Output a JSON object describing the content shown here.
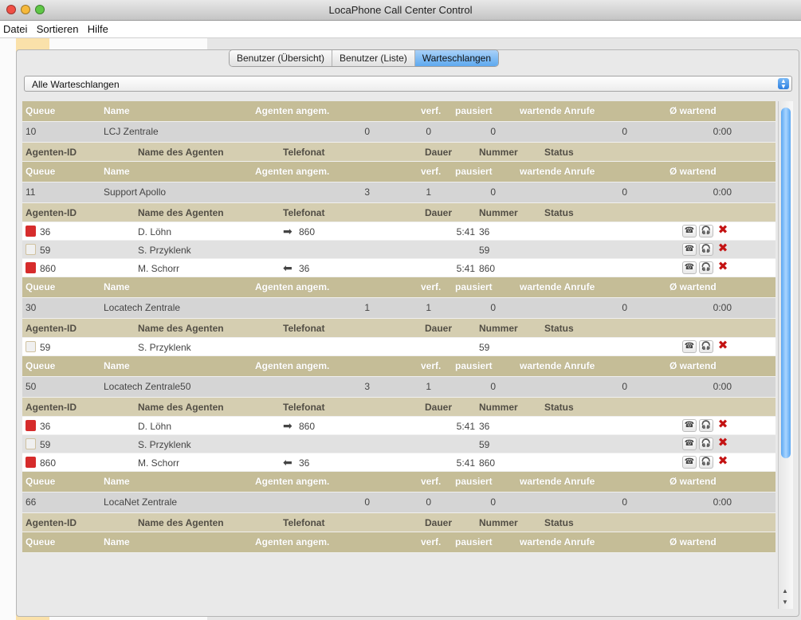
{
  "window": {
    "title": "LocaPhone Call Center Control"
  },
  "menu": [
    "Datei",
    "Sortieren",
    "Hilfe"
  ],
  "tabs": [
    "Benutzer (Übersicht)",
    "Benutzer (Liste)",
    "Warteschlangen"
  ],
  "active_tab": 2,
  "filter": {
    "selected": "Alle Warteschlangen"
  },
  "headers": {
    "queue": [
      "Queue",
      "Name",
      "Agenten angem.",
      "verf.",
      "pausiert",
      "wartende Anrufe",
      "Ø wartend"
    ],
    "agent": [
      "Agenten-ID",
      "Name des Agenten",
      "Telefonat",
      "Dauer",
      "Nummer",
      "Status"
    ]
  },
  "queues": [
    {
      "id": "10",
      "name": "LCJ Zentrale",
      "angemeldet": "0",
      "verf": "0",
      "pausiert": "0",
      "wartend": "0",
      "avg": "0:00",
      "agents": []
    },
    {
      "id": "11",
      "name": "Support Apollo",
      "angemeldet": "3",
      "verf": "1",
      "pausiert": "0",
      "wartend": "0",
      "avg": "0:00",
      "agents": [
        {
          "id": "36",
          "name": "D. Löhn",
          "call_dir": "out",
          "call": "860",
          "dauer": "5:41",
          "nummer": "36",
          "status": "busy"
        },
        {
          "id": "59",
          "name": "S. Przyklenk",
          "call_dir": "",
          "call": "",
          "dauer": "",
          "nummer": "59",
          "status": "idle"
        },
        {
          "id": "860",
          "name": "M. Schorr",
          "call_dir": "in",
          "call": "36",
          "dauer": "5:41",
          "nummer": "860",
          "status": "busy"
        }
      ]
    },
    {
      "id": "30",
      "name": "Locatech Zentrale",
      "angemeldet": "1",
      "verf": "1",
      "pausiert": "0",
      "wartend": "0",
      "avg": "0:00",
      "agents": [
        {
          "id": "59",
          "name": "S. Przyklenk",
          "call_dir": "",
          "call": "",
          "dauer": "",
          "nummer": "59",
          "status": "idle"
        }
      ]
    },
    {
      "id": "50",
      "name": "Locatech Zentrale50",
      "angemeldet": "3",
      "verf": "1",
      "pausiert": "0",
      "wartend": "0",
      "avg": "0:00",
      "agents": [
        {
          "id": "36",
          "name": "D. Löhn",
          "call_dir": "out",
          "call": "860",
          "dauer": "5:41",
          "nummer": "36",
          "status": "busy"
        },
        {
          "id": "59",
          "name": "S. Przyklenk",
          "call_dir": "",
          "call": "",
          "dauer": "",
          "nummer": "59",
          "status": "idle"
        },
        {
          "id": "860",
          "name": "M. Schorr",
          "call_dir": "in",
          "call": "36",
          "dauer": "5:41",
          "nummer": "860",
          "status": "busy"
        }
      ]
    },
    {
      "id": "66",
      "name": "LocaNet Zentrale",
      "angemeldet": "0",
      "verf": "0",
      "pausiert": "0",
      "wartend": "0",
      "avg": "0:00",
      "agents": []
    }
  ],
  "icons": {
    "phone": "phone-handset-icon",
    "listen": "headset-icon",
    "remove": "remove-x-icon",
    "out_arrow": "arrow-right-icon",
    "in_arrow": "arrow-left-icon"
  },
  "colors": {
    "queue_header": "#c5bd97",
    "agent_header": "#d5ceb1",
    "accent": "#2d7fe0",
    "remove": "#c41313",
    "busy": "#d62c2c"
  }
}
